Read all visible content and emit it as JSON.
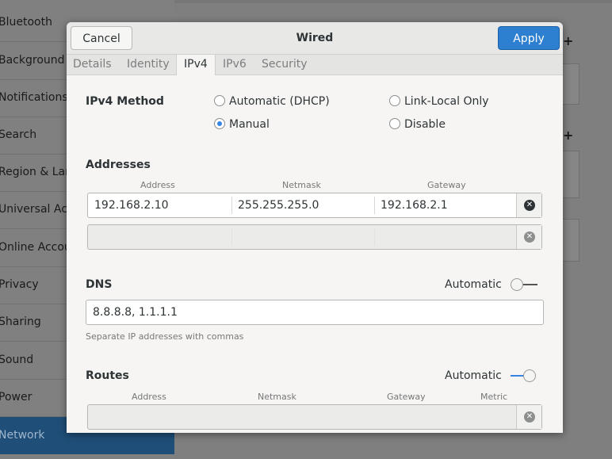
{
  "background": {
    "sidebar_items": [
      "Bluetooth",
      "Background",
      "Notifications",
      "Search",
      "Region & Language",
      "Universal Access",
      "Online Accounts",
      "Privacy",
      "Sharing",
      "Sound",
      "Power",
      "Network"
    ],
    "active_item": "Network"
  },
  "dialog": {
    "title": "Wired",
    "cancel_label": "Cancel",
    "apply_label": "Apply",
    "tabs": [
      "Details",
      "Identity",
      "IPv4",
      "IPv6",
      "Security"
    ],
    "active_tab": "IPv4"
  },
  "ipv4": {
    "method_label": "IPv4 Method",
    "methods": {
      "automatic": "Automatic (DHCP)",
      "link_local": "Link-Local Only",
      "manual": "Manual",
      "disable": "Disable"
    },
    "selected_method": "Manual"
  },
  "addresses": {
    "heading": "Addresses",
    "columns": [
      "Address",
      "Netmask",
      "Gateway"
    ],
    "rows": [
      {
        "address": "192.168.2.10",
        "netmask": "255.255.255.0",
        "gateway": "192.168.2.1"
      },
      {
        "address": "",
        "netmask": "",
        "gateway": ""
      }
    ]
  },
  "dns": {
    "heading": "DNS",
    "automatic_label": "Automatic",
    "automatic_on": false,
    "value": "8.8.8.8, 1.1.1.1",
    "hint": "Separate IP addresses with commas"
  },
  "routes": {
    "heading": "Routes",
    "automatic_label": "Automatic",
    "automatic_on": true,
    "columns": [
      "Address",
      "Netmask",
      "Gateway",
      "Metric"
    ]
  },
  "colors": {
    "accent": "#3584e4",
    "apply_button": "#2d7fd0",
    "selected_sidebar": "#1f4e78"
  }
}
